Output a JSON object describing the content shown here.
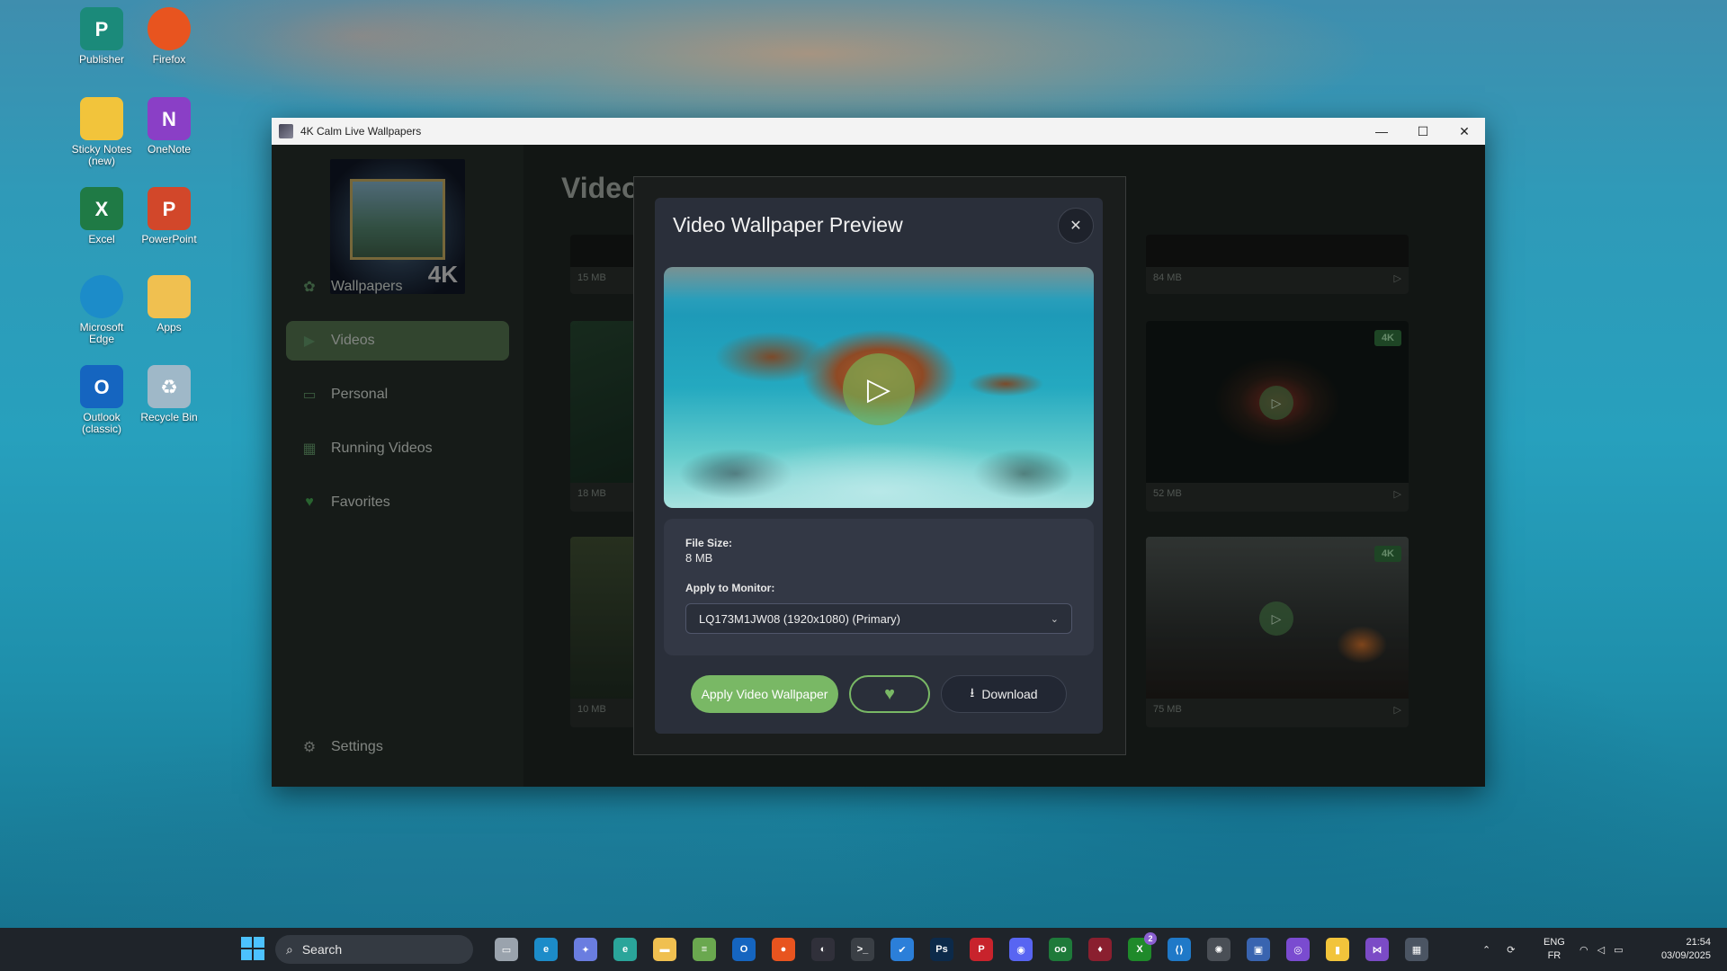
{
  "desktop": {
    "icons": [
      {
        "label": "Publisher",
        "icon": "publisher-icon",
        "color": "#1b8a7a",
        "glyph": "P"
      },
      {
        "label": "Firefox",
        "icon": "firefox-icon",
        "color": "#e8541f",
        "glyph": ""
      },
      {
        "label": "Sticky Notes (new)",
        "icon": "sticky-notes-icon",
        "color": "#f2c43b",
        "glyph": ""
      },
      {
        "label": "OneNote",
        "icon": "onenote-icon",
        "color": "#8a3fc6",
        "glyph": "N"
      },
      {
        "label": "Excel",
        "icon": "excel-icon",
        "color": "#1f7a45",
        "glyph": "X"
      },
      {
        "label": "PowerPoint",
        "icon": "powerpoint-icon",
        "color": "#d2472a",
        "glyph": "P"
      },
      {
        "label": "Microsoft Edge",
        "icon": "edge-icon",
        "color": "#1c8cc9",
        "glyph": ""
      },
      {
        "label": "Apps",
        "icon": "apps-folder-icon",
        "color": "#f0c050",
        "glyph": ""
      },
      {
        "label": "Outlook (classic)",
        "icon": "outlook-icon",
        "color": "#1565c0",
        "glyph": "O"
      },
      {
        "label": "Recycle Bin",
        "icon": "recycle-bin-icon",
        "color": "#9fb8c8",
        "glyph": "♻"
      }
    ]
  },
  "window": {
    "title": "4K Calm Live Wallpapers",
    "minimize": "—",
    "maximize": "☐",
    "close": "✕"
  },
  "sidebar": {
    "logo_badge": "4K",
    "items": [
      {
        "label": "Wallpapers",
        "icon": "wallpapers-icon",
        "glyph": "✿"
      },
      {
        "label": "Videos",
        "icon": "play-icon",
        "glyph": "▶"
      },
      {
        "label": "Personal",
        "icon": "image-folder-icon",
        "glyph": "▭"
      },
      {
        "label": "Running Videos",
        "icon": "grid-icon",
        "glyph": "▦"
      },
      {
        "label": "Favorites",
        "icon": "heart-icon",
        "glyph": "♥"
      }
    ],
    "settings": {
      "label": "Settings",
      "icon": "gear-icon",
      "glyph": "⚙"
    }
  },
  "content": {
    "heading": "Video",
    "cards": [
      {
        "size": "15 MB"
      },
      {
        "size": "84 MB"
      },
      {
        "size": "18 MB"
      },
      {
        "size": "52 MB",
        "badge": "4K"
      },
      {
        "size": "10 MB"
      },
      {
        "size": "75 MB",
        "badge": "4K"
      }
    ]
  },
  "modal": {
    "title": "Video Wallpaper Preview",
    "close_glyph": "✕",
    "file_size_label": "File Size:",
    "file_size_value": "8 MB",
    "monitor_label": "Apply to Monitor:",
    "monitor_selected": "LQ173M1JW08 (1920x1080) (Primary)",
    "apply_button": "Apply Video Wallpaper",
    "favorite_glyph": "♥",
    "download_button": "Download",
    "download_glyph": "⭳",
    "play_glyph": "▷"
  },
  "taskbar": {
    "search_placeholder": "Search",
    "apps": [
      {
        "name": "task-view-icon",
        "color": "#9aa3ad",
        "glyph": "▭"
      },
      {
        "name": "edge-taskbar-icon",
        "color": "#1c8cc9",
        "glyph": "e"
      },
      {
        "name": "copilot-icon",
        "color": "#6a7de0",
        "glyph": "✦"
      },
      {
        "name": "edge-dev-icon",
        "color": "#2aa59a",
        "glyph": "e"
      },
      {
        "name": "file-explorer-icon",
        "color": "#f0c050",
        "glyph": "▬"
      },
      {
        "name": "notepad-icon",
        "color": "#6aa84f",
        "glyph": "≡"
      },
      {
        "name": "outlook-taskbar-icon",
        "color": "#1565c0",
        "glyph": "O"
      },
      {
        "name": "firefox-taskbar-icon",
        "color": "#e8541f",
        "glyph": "●"
      },
      {
        "name": "obsidian-icon",
        "color": "#30303a",
        "glyph": "◐"
      },
      {
        "name": "terminal-icon",
        "color": "#3a3f45",
        "glyph": ">_"
      },
      {
        "name": "todo-icon",
        "color": "#2b7fd9",
        "glyph": "✔"
      },
      {
        "name": "photoshop-icon",
        "color": "#0c2a4a",
        "glyph": "Ps"
      },
      {
        "name": "pinterest-icon",
        "color": "#c8232c",
        "glyph": "P"
      },
      {
        "name": "discord-icon",
        "color": "#5865f2",
        "glyph": "◉"
      },
      {
        "name": "gamepass-icon",
        "color": "#1e7a3a",
        "glyph": "oo"
      },
      {
        "name": "rider-icon",
        "color": "#8a1f2f",
        "glyph": "♦"
      },
      {
        "name": "xbox-icon",
        "color": "#1f8a2a",
        "glyph": "X"
      },
      {
        "name": "vscode-icon",
        "color": "#1f79c8",
        "glyph": "⟨⟩"
      },
      {
        "name": "chatgpt-icon",
        "color": "#4a4f56",
        "glyph": "✺"
      },
      {
        "name": "remote-desktop-icon",
        "color": "#3964b0",
        "glyph": "▣"
      },
      {
        "name": "proton-icon",
        "color": "#7a4bd0",
        "glyph": "◎"
      },
      {
        "name": "sticky-notes-taskbar-icon",
        "color": "#f2c43b",
        "glyph": "▮"
      },
      {
        "name": "visual-studio-icon",
        "color": "#7b4bc6",
        "glyph": "⋈"
      },
      {
        "name": "wallpapers-app-icon",
        "color": "#4b5563",
        "glyph": "▦"
      }
    ],
    "xbox_badge": "2",
    "lang_top": "ENG",
    "lang_bottom": "FR",
    "time": "21:54",
    "date": "03/09/2025"
  }
}
